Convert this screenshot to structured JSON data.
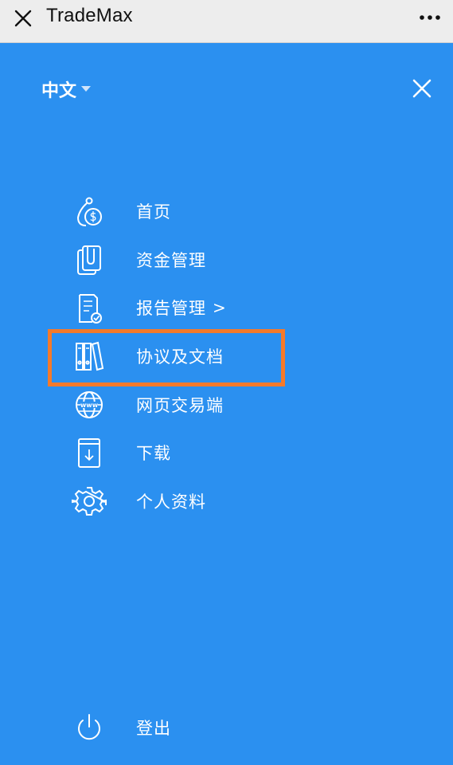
{
  "window": {
    "title": "TradeMax",
    "close_icon": "close-icon",
    "more_icon": "more-dots-icon"
  },
  "menu": {
    "language": "中文",
    "language_caret_icon": "caret-down-icon",
    "close_icon": "close-icon",
    "items": [
      {
        "label": "首页",
        "icon": "money-bag-icon"
      },
      {
        "label": "资金管理",
        "icon": "clipboard-icon"
      },
      {
        "label": "报告管理",
        "icon": "report-check-icon",
        "arrow": ">"
      },
      {
        "label": "协议及文档",
        "icon": "binders-icon",
        "highlighted": true
      },
      {
        "label": "网页交易端",
        "icon": "globe-www-icon"
      },
      {
        "label": "下载",
        "icon": "download-box-icon"
      },
      {
        "label": "个人资料",
        "icon": "gear-icon"
      }
    ],
    "logout": {
      "label": "登出",
      "icon": "power-icon"
    }
  },
  "colors": {
    "panel_bg": "#2b90f0",
    "topbar_bg": "#ededed",
    "highlight_border": "#f47a2b",
    "text": "#ffffff"
  }
}
